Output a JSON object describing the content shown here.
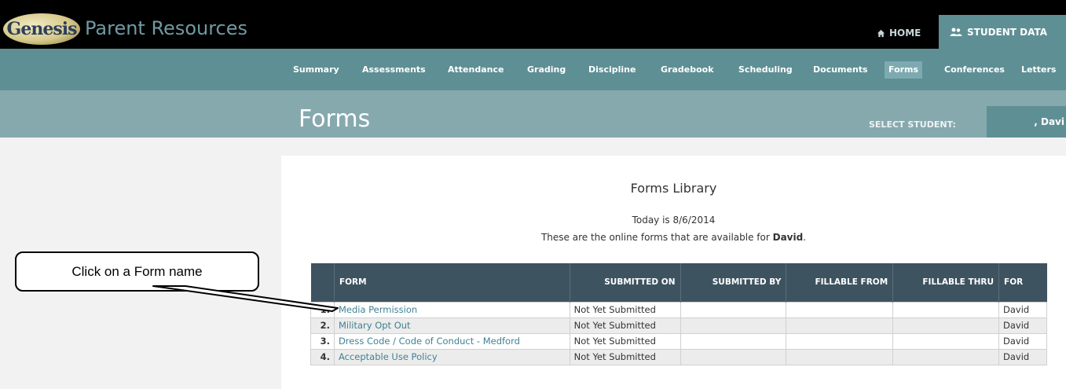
{
  "app": {
    "logo_text": "Genesis",
    "title": "Parent Resources",
    "home_label": "HOME",
    "student_data_label": "STUDENT DATA"
  },
  "nav": {
    "items": [
      {
        "label": "Summary"
      },
      {
        "label": "Assessments"
      },
      {
        "label": "Attendance"
      },
      {
        "label": "Grading"
      },
      {
        "label": "Discipline"
      },
      {
        "label": "Gradebook"
      },
      {
        "label": "Scheduling"
      },
      {
        "label": "Documents"
      },
      {
        "label": "Forms",
        "active": true
      },
      {
        "label": "Conferences"
      },
      {
        "label": "Letters"
      }
    ]
  },
  "header": {
    "page_title": "Forms",
    "select_student_label": "SELECT STUDENT:",
    "selected_student": ", Davi"
  },
  "library": {
    "title": "Forms Library",
    "today_text": "Today is 8/6/2014",
    "available_prefix": "These are the online forms that are available for ",
    "student_name": "David",
    "available_suffix": "."
  },
  "table": {
    "columns": [
      "FORM",
      "SUBMITTED ON",
      "SUBMITTED BY",
      "FILLABLE FROM",
      "FILLABLE THRU",
      "FOR"
    ],
    "rows": [
      {
        "num": "1.",
        "form": "Media Permission",
        "submitted_on": "Not Yet Submitted",
        "submitted_by": "",
        "fillable_from": "",
        "fillable_thru": "",
        "for": "David"
      },
      {
        "num": "2.",
        "form": "Military Opt Out",
        "submitted_on": "Not Yet Submitted",
        "submitted_by": "",
        "fillable_from": "",
        "fillable_thru": "",
        "for": "David"
      },
      {
        "num": "3.",
        "form": "Dress Code / Code of Conduct - Medford",
        "submitted_on": "Not Yet Submitted",
        "submitted_by": "",
        "fillable_from": "",
        "fillable_thru": "",
        "for": "David"
      },
      {
        "num": "4.",
        "form": "Acceptable Use Policy",
        "submitted_on": "Not Yet Submitted",
        "submitted_by": "",
        "fillable_from": "",
        "fillable_thru": "",
        "for": "David"
      }
    ]
  },
  "callout": {
    "text": "Click on a Form name"
  },
  "colors": {
    "topbar": "#000000",
    "nav": "#5e8f95",
    "header_band": "#86a9ae",
    "table_header": "#3e5360",
    "link": "#3f8294"
  },
  "icons": {
    "home": "home-icon",
    "student_data": "users-icon"
  }
}
